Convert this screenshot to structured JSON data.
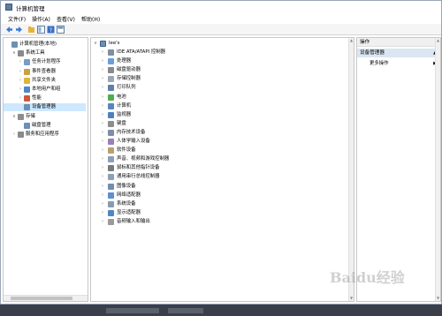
{
  "window": {
    "title": "计算机管理"
  },
  "menu": [
    {
      "label": "文件(F)"
    },
    {
      "label": "操作(A)"
    },
    {
      "label": "查看(V)"
    },
    {
      "label": "帮助(H)"
    }
  ],
  "left_tree": [
    {
      "label": "计算机管理(本地)",
      "level": 0,
      "icon": "computer-manage-icon",
      "arrow": ""
    },
    {
      "label": "系统工具",
      "level": 1,
      "icon": "tools-icon",
      "arrow": "v"
    },
    {
      "label": "任务计划程序",
      "level": 2,
      "icon": "clock-icon",
      "arrow": ">"
    },
    {
      "label": "事件查看器",
      "level": 2,
      "icon": "event-icon",
      "arrow": ">"
    },
    {
      "label": "共享文件夹",
      "level": 2,
      "icon": "folder-icon",
      "arrow": ">"
    },
    {
      "label": "本地用户和组",
      "level": 2,
      "icon": "users-icon",
      "arrow": ">"
    },
    {
      "label": "性能",
      "level": 2,
      "icon": "performance-icon",
      "arrow": ">"
    },
    {
      "label": "设备管理器",
      "level": 2,
      "icon": "device-manager-icon",
      "arrow": "",
      "selected": true
    },
    {
      "label": "存储",
      "level": 1,
      "icon": "storage-icon",
      "arrow": "v"
    },
    {
      "label": "磁盘管理",
      "level": 2,
      "icon": "disk-icon",
      "arrow": ""
    },
    {
      "label": "服务和应用程序",
      "level": 1,
      "icon": "services-icon",
      "arrow": ">"
    }
  ],
  "device_tree": {
    "root": "lee's",
    "items": [
      {
        "label": "IDE ATA/ATAPI 控制器",
        "icon": "ide-icon"
      },
      {
        "label": "处理器",
        "icon": "processor-icon"
      },
      {
        "label": "磁盘驱动器",
        "icon": "disk-drive-icon"
      },
      {
        "label": "存储控制器",
        "icon": "storage-controller-icon"
      },
      {
        "label": "打印队列",
        "icon": "printer-icon"
      },
      {
        "label": "电池",
        "icon": "battery-icon"
      },
      {
        "label": "计算机",
        "icon": "computer-icon"
      },
      {
        "label": "监视器",
        "icon": "monitor-icon"
      },
      {
        "label": "键盘",
        "icon": "keyboard-icon"
      },
      {
        "label": "内存技术设备",
        "icon": "memory-icon"
      },
      {
        "label": "人体学输入设备",
        "icon": "hid-icon"
      },
      {
        "label": "软件设备",
        "icon": "software-device-icon"
      },
      {
        "label": "声音、视频和游戏控制器",
        "icon": "sound-icon"
      },
      {
        "label": "鼠标和其他指针设备",
        "icon": "mouse-icon"
      },
      {
        "label": "通用串行总线控制器",
        "icon": "usb-icon"
      },
      {
        "label": "图像设备",
        "icon": "camera-icon"
      },
      {
        "label": "网络适配器",
        "icon": "network-icon"
      },
      {
        "label": "系统设备",
        "icon": "system-device-icon"
      },
      {
        "label": "显示适配器",
        "icon": "display-adapter-icon"
      },
      {
        "label": "音频输入和输出",
        "icon": "audio-io-icon"
      }
    ]
  },
  "actions": {
    "header": "操作",
    "selected": "设备管理器",
    "more": "更多操作"
  },
  "watermark": "Baidu经验",
  "colors": {
    "selection": "#cde8ff",
    "action_selected": "#dbe6f2",
    "taskbar": "#3a3f4a"
  }
}
